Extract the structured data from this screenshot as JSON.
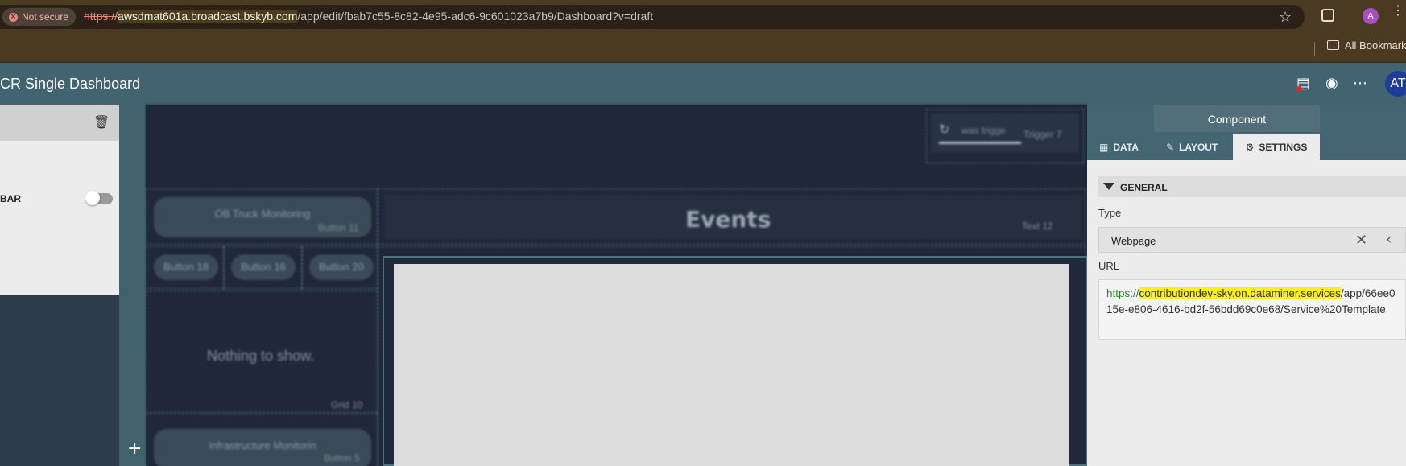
{
  "browser": {
    "not_secure": "Not secure",
    "url_scheme": "https://",
    "url_host": "awsdmat601a.broadcast.bskyb.com",
    "url_path": "/app/edit/fbab7c55-8c82-4e95-adc6-9c601023a7b9/Dashboard?v=draft",
    "profile_initial": "A",
    "bookmarks_label": "All Bookmarks"
  },
  "app": {
    "title": "CR Single Dashboard",
    "avatar": "AT"
  },
  "left_panel": {
    "toggle_label": "BAR"
  },
  "canvas": {
    "trigger_text": "was trigge",
    "trigger_tag": "Trigger 7",
    "button11_text": "OB Truck Monitoring",
    "button11_tag": "Button 11",
    "events_text": "Events",
    "text12_tag": "Text 12",
    "button18": "Button 18",
    "button16": "Button 16",
    "button20": "Button 20",
    "nothing_text": "Nothing to show.",
    "grid10_tag": "Grid 10",
    "button5_text": "Infrastructure Monitorin",
    "button5_tag": "Button 5",
    "add_symbol": "+"
  },
  "right_panel": {
    "title": "Component",
    "tabs": [
      {
        "label": "DATA",
        "icon": "table-icon"
      },
      {
        "label": "LAYOUT",
        "icon": "pencil-icon"
      },
      {
        "label": "SETTINGS",
        "icon": "gear-icon",
        "active": true
      }
    ],
    "section": "GENERAL",
    "type_label": "Type",
    "type_value": "Webpage",
    "url_label": "URL",
    "url_scheme": "https://",
    "url_host": "contributiondev-sky.on.dataminer.services",
    "url_rest": "/app/66ee015e-e806-4616-bd2f-56bdd69c0e68/Service%20Template"
  },
  "colors": {
    "header": "#426370",
    "canvas_bg": "#1f2738",
    "highlight": "#ffef1a"
  }
}
